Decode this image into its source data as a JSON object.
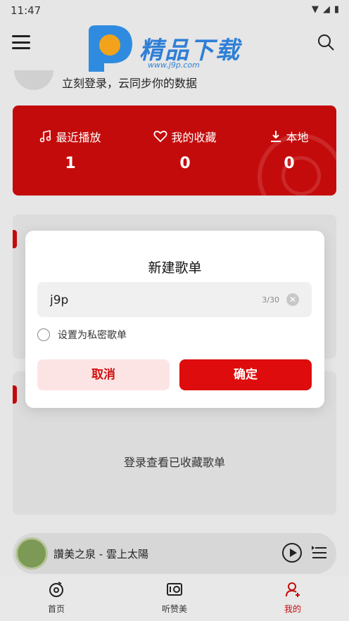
{
  "status": {
    "time": "11:47"
  },
  "watermark": {
    "brand": "精品下载",
    "url": "www.j9p.com"
  },
  "header": {
    "login_hint": "立刻登录，云同步你的数据"
  },
  "stats": [
    {
      "label": "最近播放",
      "value": "1",
      "icon": "music-note-icon"
    },
    {
      "label": "我的收藏",
      "value": "0",
      "icon": "heart-icon"
    },
    {
      "label": "本地",
      "value": "0",
      "icon": "download-icon"
    }
  ],
  "collect_section": {
    "empty_hint": "登录查看已收藏歌单"
  },
  "player": {
    "song": "讚美之泉 - 雲上太陽"
  },
  "nav": [
    {
      "label": "首页",
      "icon": "home-disc-icon"
    },
    {
      "label": "听赞美",
      "icon": "radio-icon"
    },
    {
      "label": "我的",
      "icon": "profile-icon",
      "active": true
    }
  ],
  "dialog": {
    "title": "新建歌单",
    "input_value": "j9p",
    "counter": "3/30",
    "private_label": "设置为私密歌单",
    "cancel_label": "取消",
    "confirm_label": "确定"
  },
  "colors": {
    "accent": "#c40b0b",
    "confirm": "#de0c0c",
    "cancel_bg": "#fde4e4"
  }
}
